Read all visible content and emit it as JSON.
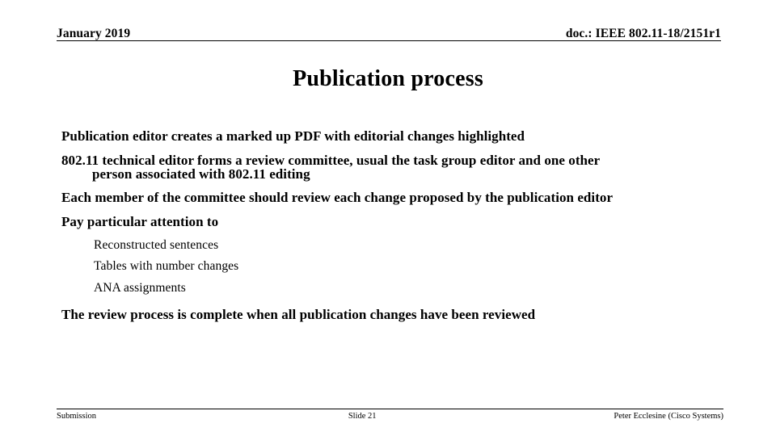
{
  "header": {
    "date": "January 2019",
    "doc": "doc.: IEEE 802.11-18/2151r1"
  },
  "title": "Publication process",
  "body": {
    "bullets": [
      {
        "level": 1,
        "text": "Publication editor creates a marked up PDF with editorial changes highlighted"
      },
      {
        "level": 1,
        "text": "802.11 technical editor forms a review committee, usual the task group editor and one other",
        "continuation": "person associated with 802.11 editing"
      },
      {
        "level": 1,
        "text": "Each member of the committee should review each change proposed by the publication editor"
      },
      {
        "level": 1,
        "text": "Pay particular attention to"
      },
      {
        "level": 2,
        "text": "Reconstructed sentences"
      },
      {
        "level": 2,
        "text": "Tables with number changes"
      },
      {
        "level": 2,
        "text": "ANA assignments"
      },
      {
        "level": 1,
        "text": "The review process is complete when all publication changes have been reviewed"
      }
    ]
  },
  "footer": {
    "left": "Submission",
    "center": "Slide 21",
    "right": "Peter Ecclesine (Cisco Systems)"
  },
  "colors": {
    "text": "#000000",
    "background": "#ffffff",
    "rule": "#000000"
  }
}
